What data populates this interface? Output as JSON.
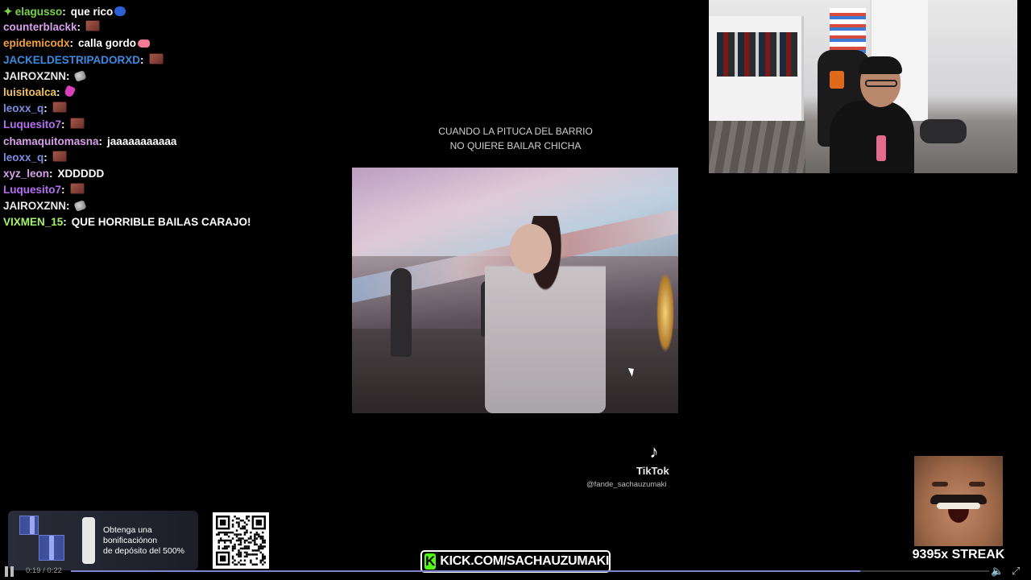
{
  "chat": {
    "messages": [
      {
        "user": "elagusso",
        "color": "#7bd34a",
        "badge": "star-icon",
        "text": "que rico",
        "emote": "blue"
      },
      {
        "user": "counterblackk",
        "color": "#d6a0ea",
        "text": "",
        "emote": "brick"
      },
      {
        "user": "epidemicodx",
        "color": "#f0a03c",
        "text": "calla gordo",
        "emote": "pig"
      },
      {
        "user": "JACKELDESTRIPADORXD",
        "color": "#3a8be0",
        "text": "",
        "emote": "brick"
      },
      {
        "user": "JAIROXZNN",
        "color": "#e8e8e8",
        "text": "",
        "emote": "grey"
      },
      {
        "user": "luisitoalca",
        "color": "#f0c060",
        "text": "",
        "emote": "pink"
      },
      {
        "user": "leoxx_q",
        "color": "#7a8de0",
        "text": "",
        "emote": "brick"
      },
      {
        "user": "Luquesito7",
        "color": "#b46ff0",
        "text": "",
        "emote": "brick"
      },
      {
        "user": "chamaquitomasna",
        "color": "#d6a0ea",
        "text": "jaaaaaaaaaaa",
        "emote": ""
      },
      {
        "user": "leoxx_q",
        "color": "#7a8de0",
        "text": "",
        "emote": "brick"
      },
      {
        "user": "xyz_leon",
        "color": "#d6a0ea",
        "text": "XDDDDD",
        "emote": ""
      },
      {
        "user": "Luquesito7",
        "color": "#b46ff0",
        "text": "",
        "emote": "brick"
      },
      {
        "user": "JAIROXZNN",
        "color": "#e8e8e8",
        "text": "",
        "emote": "grey"
      },
      {
        "user": "VIXMEN_15",
        "color": "#a6f26b",
        "text": "QUE HORRIBLE BAILAS CARAJO!",
        "emote": ""
      }
    ]
  },
  "video": {
    "caption_line1": "CUANDO LA PITUCA DEL BARRIO",
    "caption_line2": "NO QUIERE BAILAR CHICHA",
    "tiktok_label": "TikTok",
    "tiktok_handle": "@fande_sachauzumaki"
  },
  "streak": {
    "label": "9395x STREAK"
  },
  "promo": {
    "line1": "Obtenga una",
    "line2": "bonificaciónon",
    "line3": "de depósito del 500%"
  },
  "kick": {
    "logo_letter": "K",
    "url": "KICK.COM/SACHAUZUMAKI"
  },
  "player": {
    "time": "0:19 / 0:22",
    "progress": 0.86
  }
}
